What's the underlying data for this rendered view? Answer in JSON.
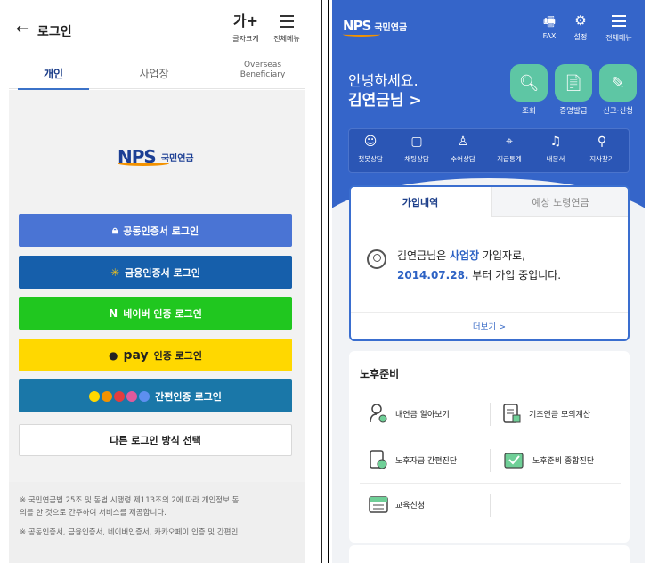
{
  "left": {
    "title": "로그인",
    "font_size_label": "글자크게",
    "font_size_glyph": "가+",
    "menu_label": "전체메뉴",
    "tabs": [
      "개인",
      "사업장",
      "Overseas",
      "Beneficiary"
    ],
    "logo_text": "NPS",
    "logo_ko": "국민연금",
    "buttons": {
      "cert": "공동인증서 로그인",
      "financial": "금융인증서 로그인",
      "naver": "네이버 인증 로그인",
      "kakao_word": "pay",
      "kakao": "인증 로그인",
      "simple": "간편인증 로그인",
      "other": "다른 로그인 방식 선택"
    },
    "notice": [
      "※ 국민연금법 25조 및 동법 시행령 제113조의 2에 따라 개인정보 동",
      "의를 한 것으로 간주하여 서비스를 제공합니다.",
      "※ 공동인증서, 금융인증서, 네이버인증서, 카카오페이 인증 및 간편인"
    ]
  },
  "right": {
    "logo_text": "NPS",
    "logo_ko": "국민연금",
    "header": {
      "fax": "FAX",
      "settings": "설정",
      "menu": "전체메뉴"
    },
    "greeting": "안녕하세요.",
    "user_name": "김연금님 >",
    "quick": [
      "조회",
      "증명발급",
      "신고·신청"
    ],
    "menu_items": [
      "챗봇상담",
      "채팅상담",
      "수어상담",
      "지급통계",
      "내문서",
      "지사찾기"
    ],
    "card_tabs": [
      "가입내역",
      "예상 노령연금"
    ],
    "msg_pre": "김연금님은 ",
    "msg_hl1": "사업장",
    "msg_mid": " 가입자로,",
    "msg_hl2": "2014.07.28.",
    "msg_post": " 부터 가입 중입니다.",
    "more": "더보기 >",
    "retire_title": "노후준비",
    "retire_items": [
      "내연금 알아보기",
      "기초연금 모의계산",
      "노후자금 간편진단",
      "노후준비 종합진단",
      "교육신청"
    ]
  },
  "colors": {
    "primary": "#3565c9",
    "accent": "#f39200",
    "naver": "#20c71f",
    "kakao": "#ffd800",
    "mint": "#5ec6a4"
  }
}
